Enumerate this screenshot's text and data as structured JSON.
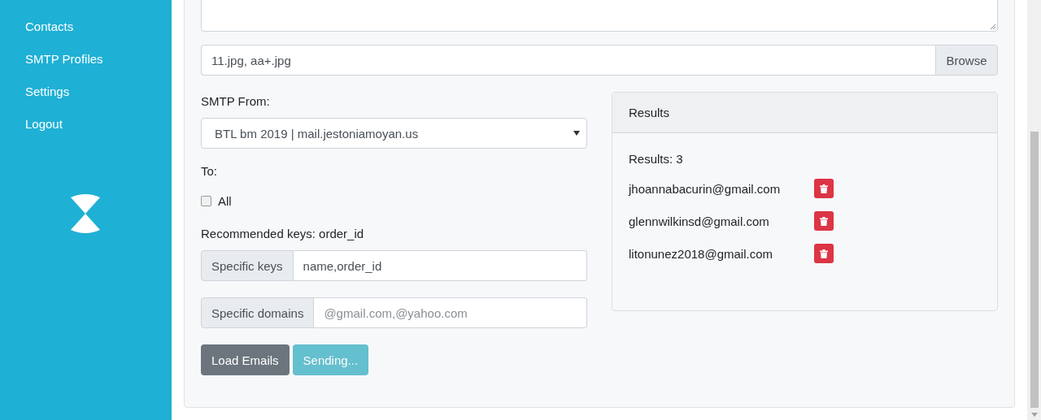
{
  "sidebar": {
    "items": [
      {
        "label": "Contacts"
      },
      {
        "label": "SMTP Profiles"
      },
      {
        "label": "Settings"
      },
      {
        "label": "Logout"
      }
    ]
  },
  "form": {
    "attachments": {
      "value": "11.jpg, aa+.jpg",
      "button": "Browse"
    },
    "smtp_from": {
      "label": "SMTP From:",
      "value": "BTL bm 2019 | mail.jestoniamoyan.us"
    },
    "to": {
      "label": "To:",
      "all": {
        "label": "All",
        "checked": false
      }
    },
    "recommended_keys": "Recommended keys: order_id",
    "specific_keys": {
      "label": "Specific keys",
      "value": "name,order_id"
    },
    "specific_domains": {
      "label": "Specific domains",
      "placeholder": "@gmail.com,@yahoo.com"
    },
    "buttons": [
      {
        "label": "Load Emails",
        "kind": "secondary",
        "disabled": false
      },
      {
        "label": "Sending...",
        "kind": "info",
        "disabled": true
      }
    ]
  },
  "results": {
    "title": "Results",
    "count": "Results: 3",
    "emails": [
      "jhoannabacurin@gmail.com",
      "glennwilkinsd@gmail.com",
      "litonunez2018@gmail.com"
    ]
  }
}
